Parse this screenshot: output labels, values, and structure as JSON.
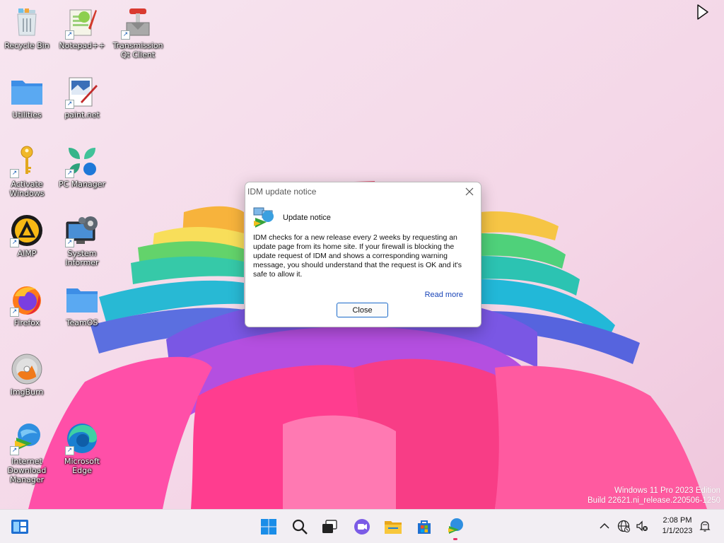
{
  "desktop": {
    "icons": [
      {
        "label": "Recycle Bin",
        "icon": "recycle-bin-icon"
      },
      {
        "label": "Notepad++",
        "icon": "notepad-plus-plus-icon"
      },
      {
        "label": "Transmission Qt Client",
        "icon": "transmission-icon"
      },
      {
        "label": "Utilities",
        "icon": "folder-icon"
      },
      {
        "label": "paint.net",
        "icon": "paint-net-icon"
      },
      {
        "label": "Activate Windows",
        "icon": "key-icon"
      },
      {
        "label": "PC Manager",
        "icon": "pc-manager-icon"
      },
      {
        "label": "AIMP",
        "icon": "aimp-icon"
      },
      {
        "label": "System Informer",
        "icon": "system-informer-icon"
      },
      {
        "label": "Firefox",
        "icon": "firefox-icon"
      },
      {
        "label": "TeamOS",
        "icon": "folder-icon"
      },
      {
        "label": "ImgBurn",
        "icon": "imgburn-icon"
      },
      {
        "label": "Internet Download Manager",
        "icon": "idm-icon"
      },
      {
        "label": "Microsoft Edge",
        "icon": "edge-icon"
      }
    ]
  },
  "dialog": {
    "title": "IDM update notice",
    "heading": "Update notice",
    "body": "IDM checks for a new release every 2 weeks by requesting an update page from its home site. If your firewall is blocking the update request of IDM and shows a corresponding warning message, you should understand that the request is OK and it's safe to allow it.",
    "read_more": "Read more",
    "close_label": "Close"
  },
  "watermark": {
    "line1": "Windows 11 Pro 2023 Edition",
    "line2": "Build 22621.ni_release.220506-1250"
  },
  "taskbar": {
    "pinned": [
      "windows-start-icon",
      "search-icon",
      "task-view-icon",
      "chat-icon",
      "file-explorer-icon",
      "microsoft-store-icon",
      "idm-icon"
    ],
    "clock": {
      "time": "2:08 PM",
      "date": "1/1/2023"
    }
  },
  "colors": {
    "accent": "#1b6ac9",
    "link": "#1a45b8",
    "taskbar": "#f2eef3"
  }
}
